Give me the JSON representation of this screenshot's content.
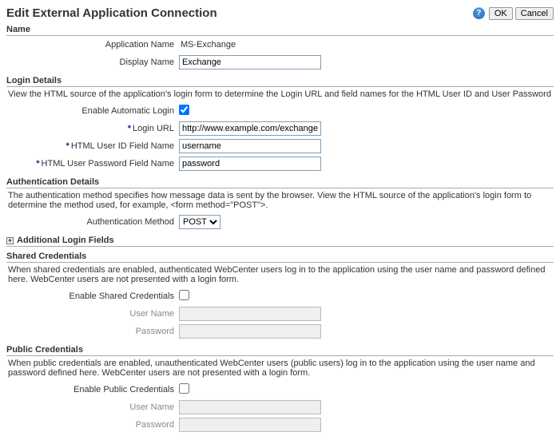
{
  "header": {
    "title": "Edit External Application Connection",
    "ok": "OK",
    "cancel": "Cancel"
  },
  "sections": {
    "name": {
      "header": "Name",
      "appNameLabel": "Application Name",
      "appNameValue": "MS-Exchange",
      "displayNameLabel": "Display Name",
      "displayNameValue": "Exchange"
    },
    "login": {
      "header": "Login Details",
      "desc": "View the HTML source of the application's login form to determine the Login URL and field names for the HTML User ID and User Password",
      "enableAutoLabel": "Enable Automatic Login",
      "loginUrlLabel": "Login URL",
      "loginUrlValue": "http://www.example.com/exchange",
      "userIdFieldLabel": "HTML User ID Field Name",
      "userIdFieldValue": "username",
      "pwdFieldLabel": "HTML User Password Field Name",
      "pwdFieldValue": "password"
    },
    "auth": {
      "header": "Authentication Details",
      "desc": "The authentication method specifies how message data is sent by the browser. View the HTML source of the application's login form to determine the method used, for example, <form method=\"POST\">.",
      "methodLabel": "Authentication Method",
      "methodValue": "POST",
      "additional": "Additional Login Fields"
    },
    "shared": {
      "header": "Shared Credentials",
      "desc": "When shared credentials are enabled, authenticated WebCenter users log in to the application using the user name and password defined here. WebCenter users are not presented with a login form.",
      "enableLabel": "Enable Shared Credentials",
      "userLabel": "User Name",
      "pwdLabel": "Password"
    },
    "public": {
      "header": "Public Credentials",
      "desc": "When public credentials are enabled, unauthenticated WebCenter users (public users) log in to the application using the user name and password defined here. WebCenter users are not presented with a login form.",
      "enableLabel": "Enable Public Credentials",
      "userLabel": "User Name",
      "pwdLabel": "Password"
    }
  }
}
